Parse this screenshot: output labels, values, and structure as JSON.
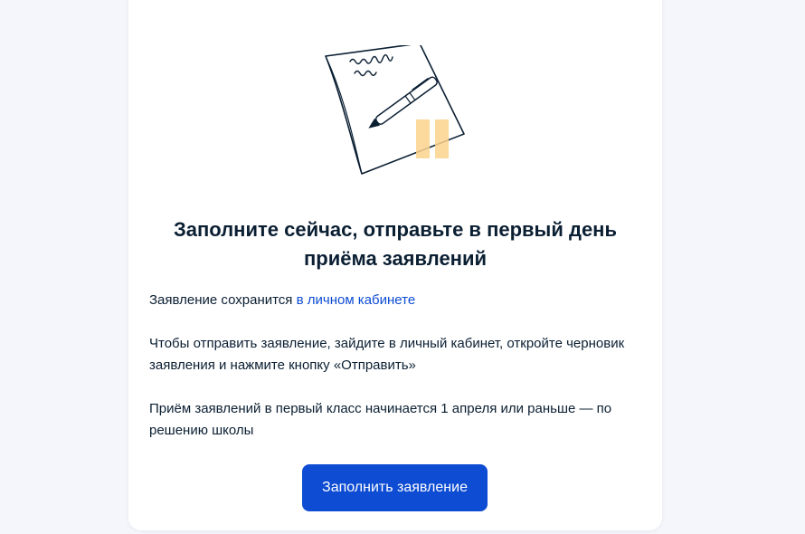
{
  "modal": {
    "title": "Заполните сейчас, отправьте в первый день приёма заявлений",
    "paragraph1": {
      "text": "Заявление сохранится ",
      "link": "в личном кабинете"
    },
    "paragraph2": "Чтобы отправить заявление, зайдите в личный кабинет, откройте черновик заявления и нажмите кнопку «Отправить»",
    "paragraph3": "Приём заявлений в первый класс начинается 1 апреля или раньше — по решению школы",
    "button_label": "Заполнить заявление",
    "illustration_icon": "document-pen-pause-icon"
  },
  "colors": {
    "primary": "#0d4cd3",
    "text": "#0b1f33",
    "background": "#f4f6fb",
    "pause_accent": "#fbd38d"
  }
}
